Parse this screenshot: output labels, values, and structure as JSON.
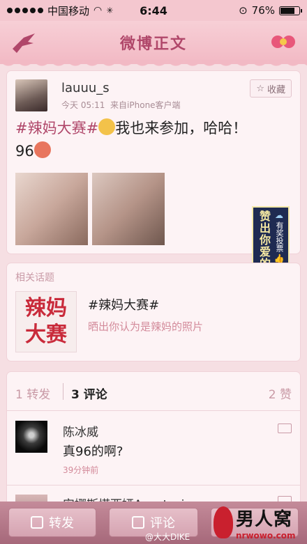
{
  "status_bar": {
    "carrier": "中国移动",
    "time": "6:44",
    "battery": "76%",
    "battery_level": 0.76
  },
  "header": {
    "title": "微博正文"
  },
  "post": {
    "username": "lauuu_s",
    "time": "今天 05:11",
    "source": "来自iPhone客户端",
    "favorite_label": "收藏",
    "hashtag": "#辣妈大赛#",
    "text": "我也来参加，哈哈！",
    "text_line2": "96"
  },
  "vote_banner": {
    "main": "赞出你爱的方言",
    "sub": "有奖投票"
  },
  "topic": {
    "section_label": "相关话题",
    "image_text_1": "辣妈",
    "image_text_2": "大赛",
    "title": "#辣妈大赛#",
    "description": "晒出你认为是辣妈的照片"
  },
  "tabs": {
    "repost": "1 转发",
    "comment": "3 评论",
    "like": "2 赞"
  },
  "comments": [
    {
      "name": "陈冰威",
      "text": "真96的啊?",
      "time": "39分钟前"
    },
    {
      "name": "安娜斯塔西娅Anastasia"
    }
  ],
  "toolbar": {
    "repost": "转发",
    "comment": "评论"
  },
  "watermark": {
    "logo_text": "男人窝",
    "logo_url": "nrwowo.com",
    "weibo": "@大大DIKE"
  }
}
